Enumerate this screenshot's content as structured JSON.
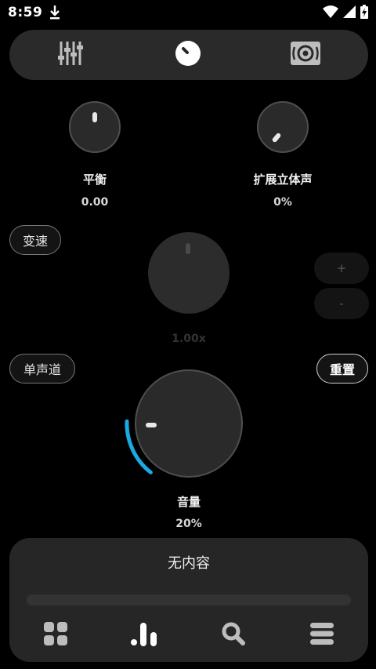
{
  "status_bar": {
    "time": "8:59",
    "icons": [
      "download-icon",
      "wifi-icon",
      "cellular-signal-icon",
      "battery-charging-icon"
    ]
  },
  "top_tabs": [
    {
      "name": "equalizer",
      "icon": "equalizer-sliders-icon",
      "active": false
    },
    {
      "name": "knob",
      "icon": "knob-icon",
      "active": true
    },
    {
      "name": "speaker",
      "icon": "speaker-icon",
      "active": false
    }
  ],
  "balance": {
    "label": "平衡",
    "value": "0.00"
  },
  "stereo_expand": {
    "label": "扩展立体声",
    "value": "0%"
  },
  "speed": {
    "button_label": "变速",
    "value": "1.00x",
    "plus_label": "+",
    "minus_label": "-"
  },
  "mono_button_label": "单声道",
  "reset_button_label": "重置",
  "volume": {
    "label": "音量",
    "value": "20%",
    "level": 0.2,
    "accent_color": "#1aa9e2"
  },
  "player": {
    "title": "无内容",
    "progress": 0,
    "nav": [
      "grid-icon",
      "bar-chart-icon",
      "search-icon",
      "menu-icon"
    ]
  }
}
